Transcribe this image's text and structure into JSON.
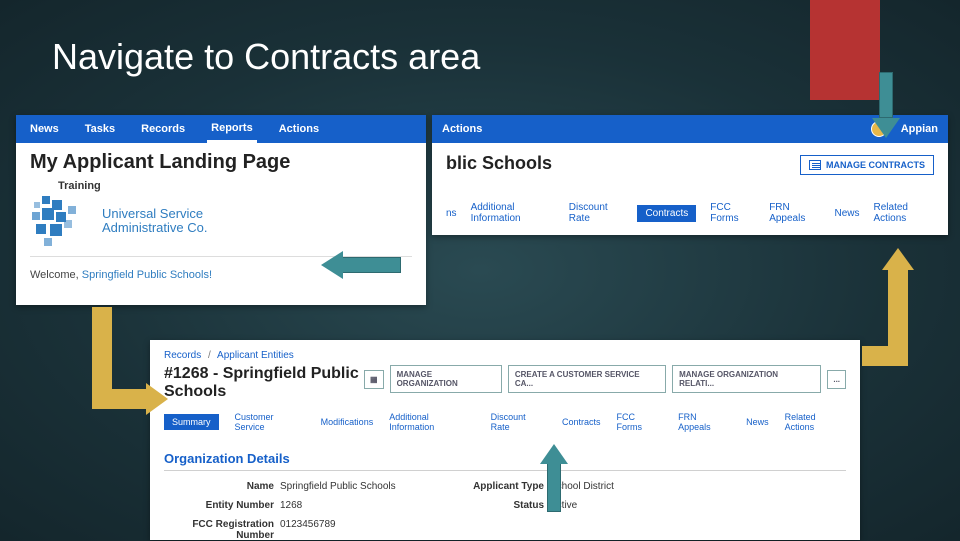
{
  "slide_title": "Navigate to Contracts area",
  "card1": {
    "nav": [
      "News",
      "Tasks",
      "Records",
      "Reports",
      "Actions"
    ],
    "nav_active_index": 3,
    "landing_title": "My Applicant Landing Page",
    "training_label": "Training",
    "usac_line1": "Universal Service",
    "usac_line2": "Administrative Co.",
    "welcome_prefix": "Welcome, ",
    "welcome_org": "Springfield Public Schools!"
  },
  "card2": {
    "nav_left": [
      "Actions"
    ],
    "brand": "Appian",
    "title_suffix": "blic Schools",
    "manage_contracts": "MANAGE CONTRACTS",
    "tabs": [
      "ns",
      "Additional Information",
      "Discount Rate",
      "Contracts",
      "FCC Forms",
      "FRN Appeals",
      "News",
      "Related Actions"
    ],
    "tabs_selected_index": 3
  },
  "card3": {
    "breadcrumb": [
      "Records",
      "Applicant Entities"
    ],
    "title": "#1268 - Springfield Public Schools",
    "buttons": [
      "MANAGE ORGANIZATION",
      "CREATE A CUSTOMER SERVICE CA...",
      "MANAGE ORGANIZATION RELATI...",
      "..."
    ],
    "tabs": [
      "Summary",
      "Customer Service",
      "Modifications",
      "Additional Information",
      "Discount Rate",
      "Contracts",
      "FCC Forms",
      "FRN Appeals",
      "News",
      "Related Actions"
    ],
    "tabs_selected_index": 0,
    "section_heading": "Organization Details",
    "details_left": [
      {
        "label": "Name",
        "value": "Springfield Public Schools"
      },
      {
        "label": "Entity Number",
        "value": "1268"
      },
      {
        "label": "FCC Registration Number",
        "value": "0123456789"
      }
    ],
    "details_right": [
      {
        "label": "Applicant Type",
        "value": "School District"
      },
      {
        "label": "Status",
        "value": "Active"
      }
    ]
  }
}
